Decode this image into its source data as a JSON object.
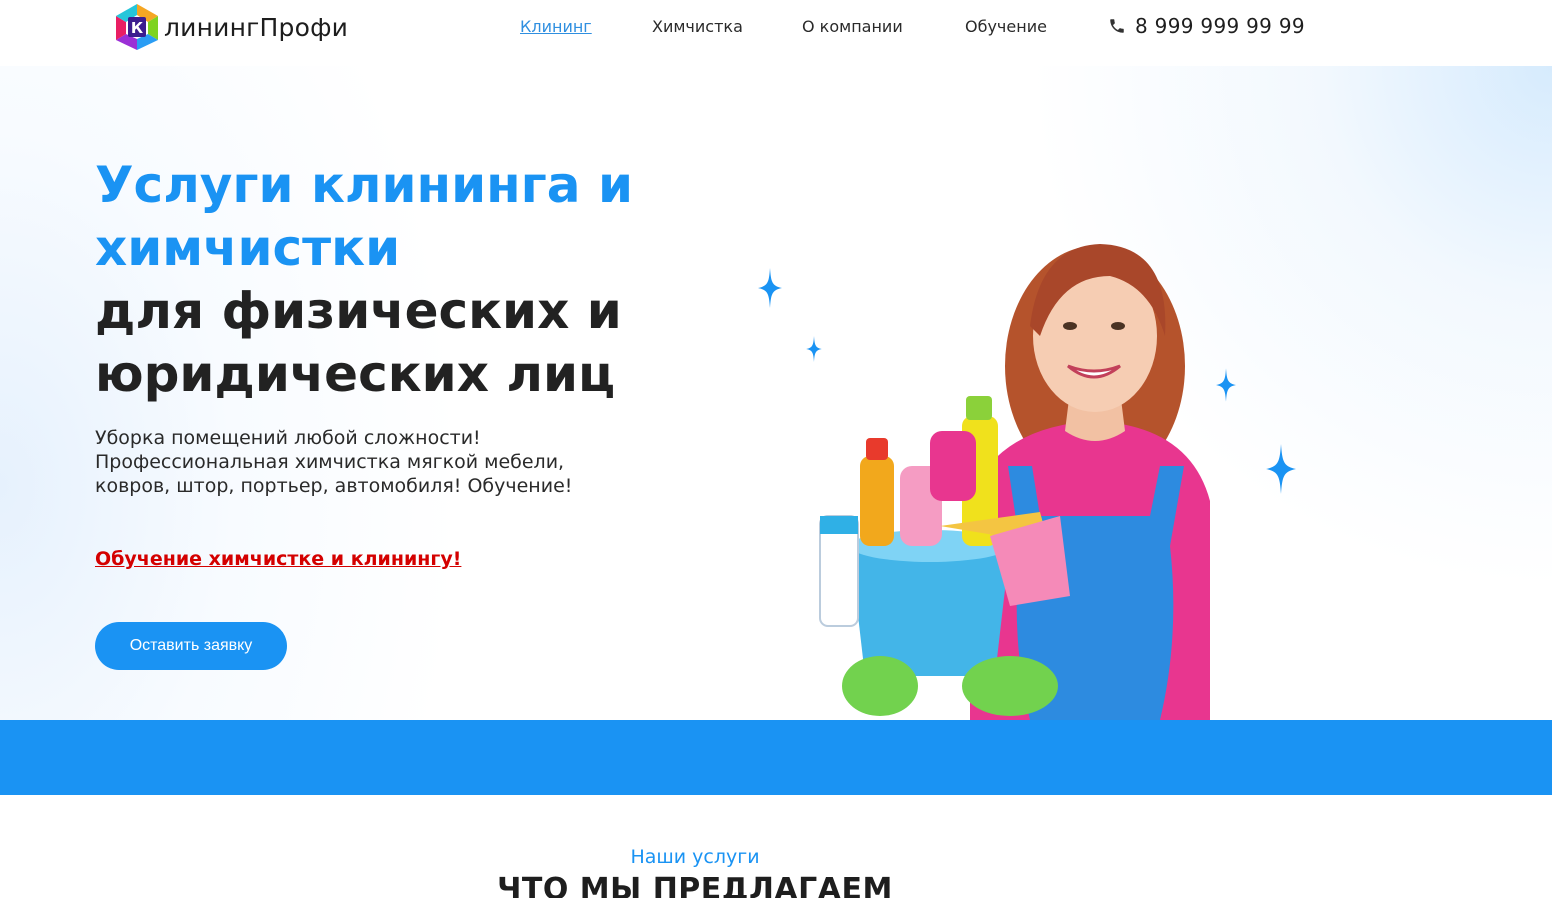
{
  "header": {
    "logo_text": "линингПрофи",
    "logo_mark_letter": "К",
    "nav": [
      {
        "label": "Клининг",
        "active": true
      },
      {
        "label": "Химчистка",
        "active": false
      },
      {
        "label": "О компании",
        "active": false
      },
      {
        "label": "Обучение",
        "active": false
      }
    ],
    "phone": "8 999 999 99 99",
    "phone_icon": "phone-icon"
  },
  "hero": {
    "title_line1": "Услуги клининга и",
    "title_line2": "химчистки",
    "title_line3": "для физических и",
    "title_line4": "юридических лиц",
    "subtitle_lines": [
      "Уборка помещений любой сложности!",
      "Профессиональная химчистка мягкой мебели,",
      "ковров, штор, портьер, автомобиля! Обучение!"
    ],
    "promo_link": "Обучение химчистке и клинингу!",
    "cta_label": "Оставить заявку"
  },
  "services": {
    "kicker": "Наши услуги",
    "title": "ЧТО МЫ ПРЕДЛАГАЕМ"
  },
  "colors": {
    "accent": "#1a93f3",
    "promo": "#d40000",
    "text": "#222222"
  }
}
